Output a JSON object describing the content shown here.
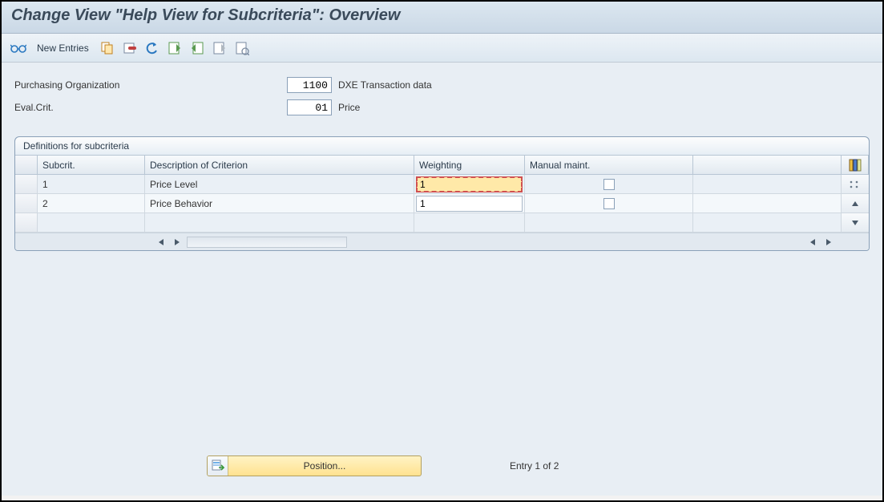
{
  "title": "Change View \"Help View for Subcriteria\": Overview",
  "toolbar": {
    "new_entries_label": "New Entries"
  },
  "header_fields": {
    "purch_org_label": "Purchasing Organization",
    "purch_org_value": "1100",
    "purch_org_desc": "DXE Transaction data",
    "eval_crit_label": "Eval.Crit.",
    "eval_crit_value": "01",
    "eval_crit_desc": "Price"
  },
  "panel": {
    "title": "Definitions for subcriteria",
    "columns": {
      "subcrit": "Subcrit.",
      "description": "Description of Criterion",
      "weighting": "Weighting",
      "manual": "Manual maint."
    },
    "rows": [
      {
        "subcrit": "1",
        "description": "Price Level",
        "weighting": "1",
        "manual": false,
        "active": true
      },
      {
        "subcrit": "2",
        "description": "Price Behavior",
        "weighting": "1",
        "manual": false,
        "active": false
      }
    ]
  },
  "footer": {
    "position_label": "Position...",
    "entry_text": "Entry 1 of 2"
  }
}
